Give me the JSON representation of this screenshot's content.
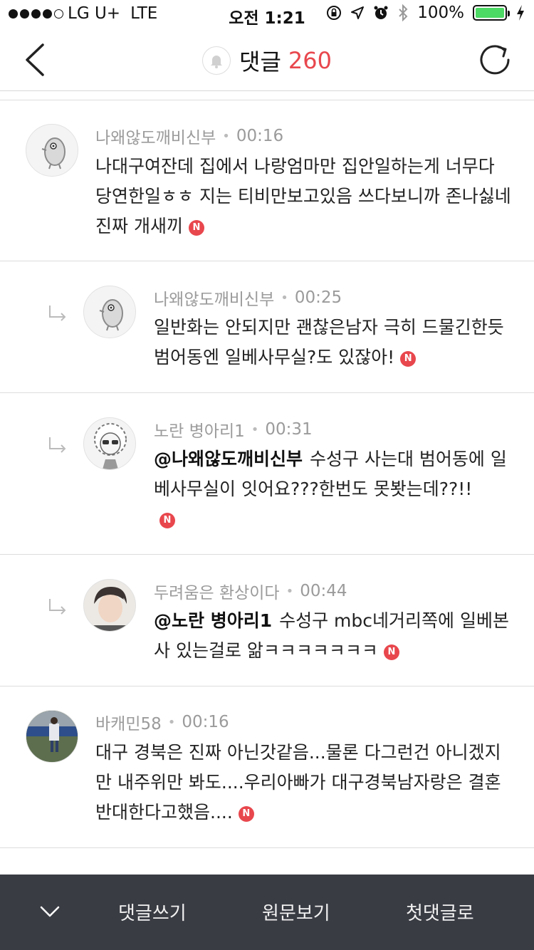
{
  "status_bar": {
    "carrier": "LG U+",
    "network": "LTE",
    "time": "오전 1:21",
    "battery": "100%"
  },
  "header": {
    "title": "댓글",
    "count": "260"
  },
  "comments": [
    {
      "author": "나왜않도깨비신부",
      "time": "00:16",
      "mention": "",
      "text": "나대구여잔데 집에서 나랑엄마만 집안일하는게 너무다 당연한일ㅎㅎ 지는 티비만보고있음 쓰다보니까 존나싫네진짜 개새끼",
      "is_reply": false,
      "avatar": "ghost-character-avatar"
    },
    {
      "author": "나왜않도깨비신부",
      "time": "00:25",
      "mention": "",
      "text": "일반화는 안되지만 괜찮은남자 극히 드물긴한듯 범어동엔 일베사무실?도 있잖아!",
      "is_reply": true,
      "avatar": "ghost-character-avatar"
    },
    {
      "author": "노란 병아리1",
      "time": "00:31",
      "mention": "@나왜않도깨비신부",
      "text": "수성구 사는대 범어동에 일베사무실이 잇어요???한번도 못봣는데??!!",
      "is_reply": true,
      "avatar": "curly-character-avatar"
    },
    {
      "author": "두려움은 환상이다",
      "time": "00:44",
      "mention": "@노란 병아리1",
      "text": "수성구 mbc네거리쪽에 일베본사 있는걸로 앎ㅋㅋㅋㅋㅋㅋㅋ",
      "is_reply": true,
      "avatar": "photo-avatar"
    },
    {
      "author": "바캐민58",
      "time": "00:16",
      "mention": "",
      "text": "대구 경북은 진짜 아닌갓같음...물론 다그런건 아니겠지만 내주위만 봐도....우리아빠가 대구경북남자랑은 결혼 반대한다고했음....",
      "is_reply": false,
      "avatar": "photo-avatar"
    }
  ],
  "new_badge_label": "N",
  "bottom_bar": {
    "write": "댓글쓰기",
    "original": "원문보기",
    "first": "첫댓글로"
  },
  "colors": {
    "accent": "#e8474d",
    "bottom_bar_bg": "#3a3c44",
    "battery": "#4cd964"
  }
}
